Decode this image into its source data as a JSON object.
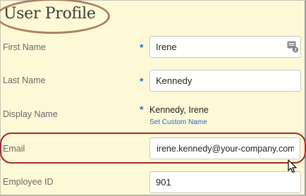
{
  "page": {
    "title": "User Profile"
  },
  "form": {
    "first_name": {
      "label": "First Name",
      "value": "Irene",
      "required_mark": "*"
    },
    "last_name": {
      "label": "Last Name",
      "value": "Kennedy",
      "required_mark": "*"
    },
    "display_name": {
      "label": "Display Name",
      "value": "Kennedy, Irene",
      "required_mark": "*",
      "link": "Set Custom Name"
    },
    "email": {
      "label": "Email",
      "value": "irene.kennedy@your-company.com"
    },
    "employee_id": {
      "label": "Employee ID",
      "value": "901"
    }
  },
  "icons": {
    "first_name_field": "contact-card-icon",
    "pointer": "mouse-cursor-icon"
  },
  "colors": {
    "background": "#fdf8d6",
    "required": "#2b6cd6",
    "link": "#2f68c7",
    "title_annotation": "#a98060",
    "email_annotation": "#9e2a2a"
  }
}
